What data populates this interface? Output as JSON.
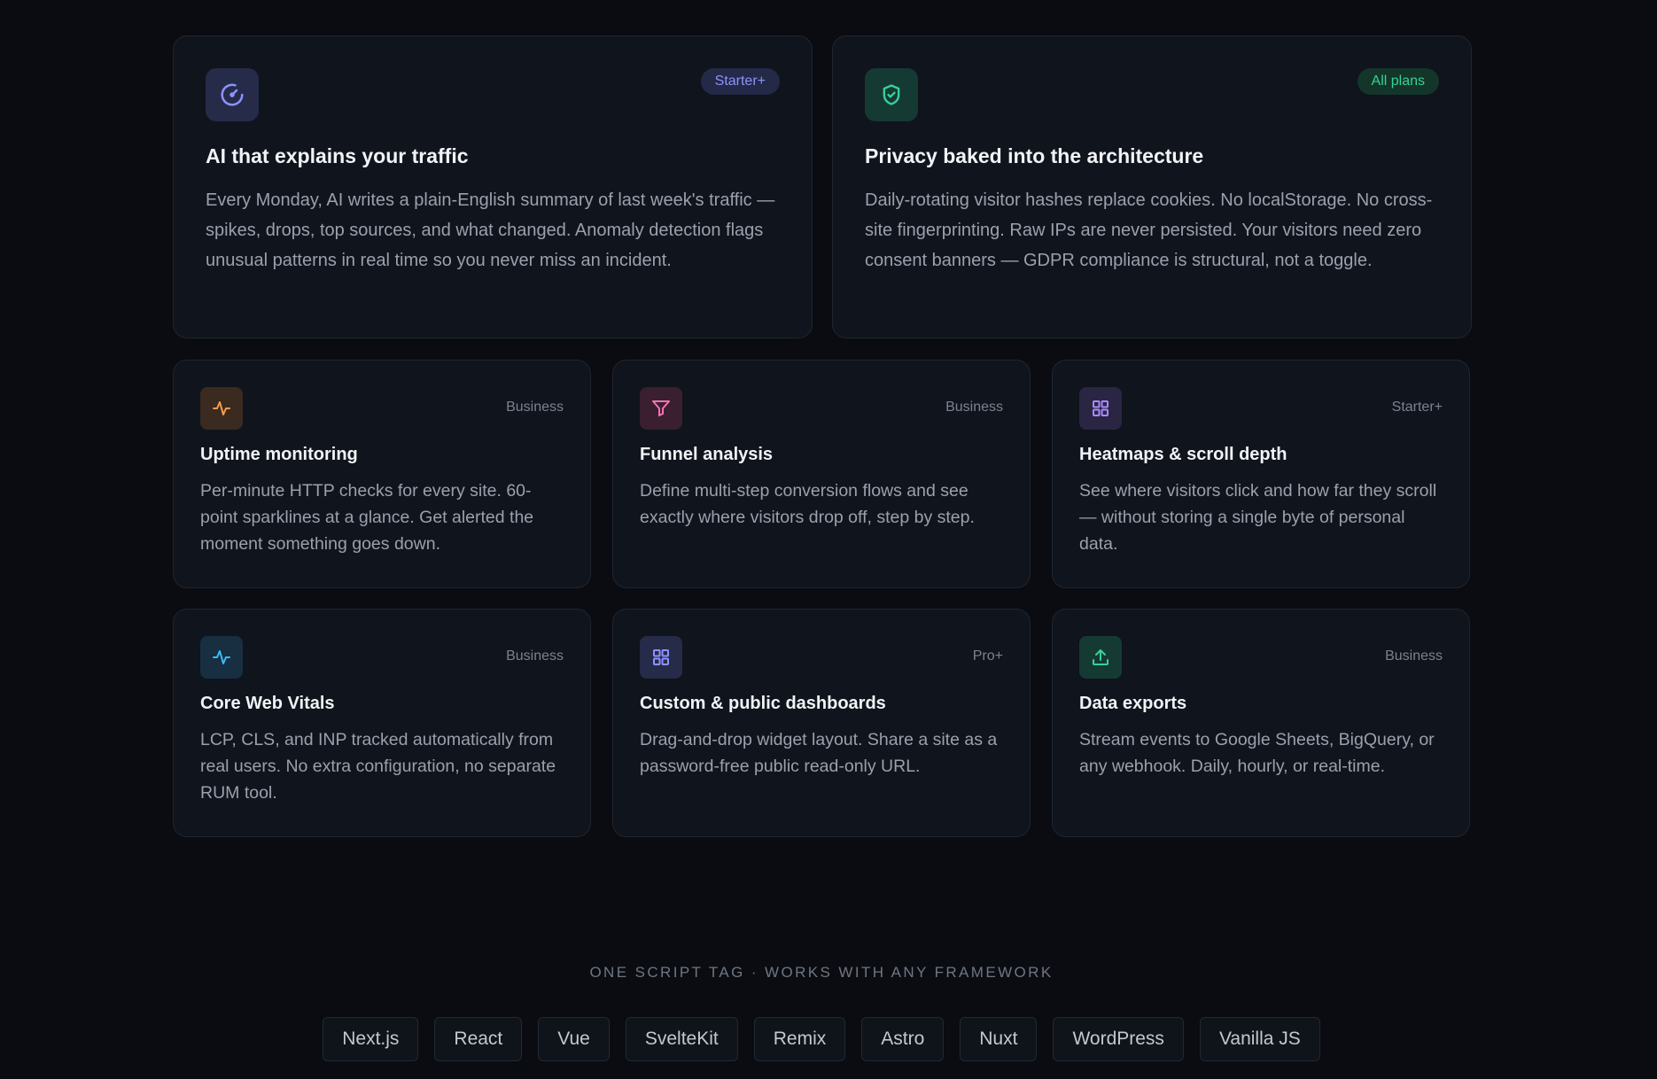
{
  "colors": {
    "background": "#0a0c11",
    "card": "#10141c",
    "indigo": "#8b93ff",
    "green": "#34d399",
    "orange": "#f59e4b",
    "pink": "#f472b6",
    "purple": "#a78bfa",
    "sky": "#38bdf8"
  },
  "features_large": [
    {
      "icon": "gauge-icon",
      "badge": "Starter+",
      "title": "AI that explains your traffic",
      "description": "Every Monday, AI writes a plain-English summary of last week's traffic — spikes, drops, top sources, and what changed. Anomaly detection flags unusual patterns in real time so you never miss an incident."
    },
    {
      "icon": "shield-check-icon",
      "badge": "All plans",
      "title": "Privacy baked into the architecture",
      "description": "Daily-rotating visitor hashes replace cookies. No localStorage. No cross-site fingerprinting. Raw IPs are never persisted. Your visitors need zero consent banners — GDPR compliance is structural, not a toggle."
    }
  ],
  "features_small": [
    {
      "icon": "activity-icon",
      "badge": "Business",
      "title": "Uptime monitoring",
      "description": "Per-minute HTTP checks for every site. 60-point sparklines at a glance. Get alerted the moment something goes down."
    },
    {
      "icon": "funnel-icon",
      "badge": "Business",
      "title": "Funnel analysis",
      "description": "Define multi-step conversion flows and see exactly where visitors drop off, step by step."
    },
    {
      "icon": "grid-icon",
      "badge": "Starter+",
      "title": "Heatmaps & scroll depth",
      "description": "See where visitors click and how far they scroll — without storing a single byte of personal data."
    },
    {
      "icon": "activity-icon",
      "badge": "Business",
      "title": "Core Web Vitals",
      "description": "LCP, CLS, and INP tracked automatically from real users. No extra configuration, no separate RUM tool."
    },
    {
      "icon": "grid-icon",
      "badge": "Pro+",
      "title": "Custom & public dashboards",
      "description": "Drag-and-drop widget layout. Share a site as a password-free public read-only URL."
    },
    {
      "icon": "upload-icon",
      "badge": "Business",
      "title": "Data exports",
      "description": "Stream events to Google Sheets, BigQuery, or any webhook. Daily, hourly, or real-time."
    }
  ],
  "frameworks": {
    "title": "ONE SCRIPT TAG · WORKS WITH ANY FRAMEWORK",
    "items": [
      "Next.js",
      "React",
      "Vue",
      "SvelteKit",
      "Remix",
      "Astro",
      "Nuxt",
      "WordPress",
      "Vanilla JS"
    ]
  }
}
